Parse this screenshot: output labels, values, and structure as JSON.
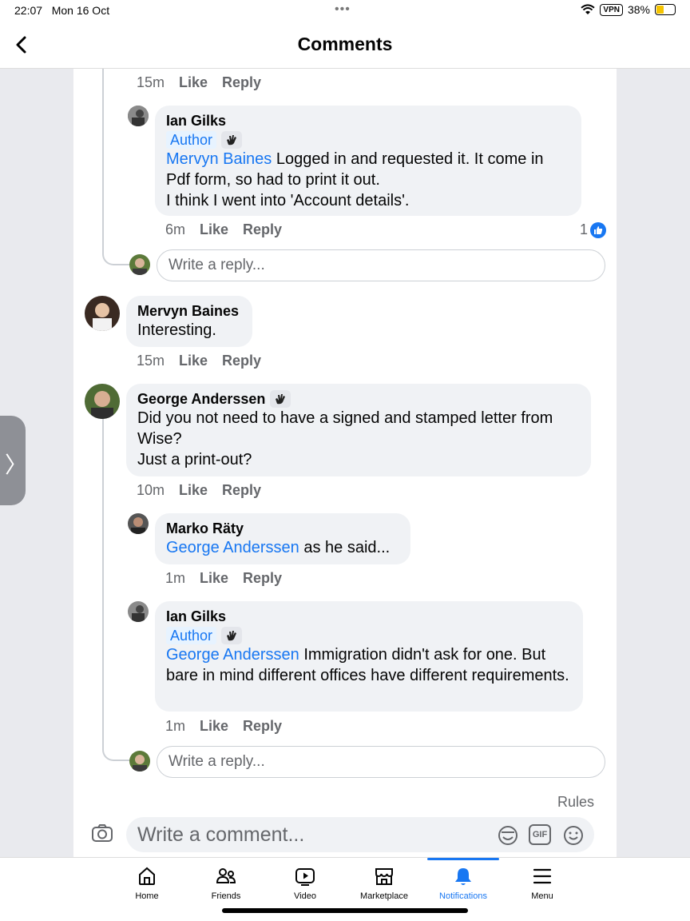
{
  "status_bar": {
    "time": "22:07",
    "date": "Mon 16 Oct",
    "vpn": "VPN",
    "battery": "38%"
  },
  "header": {
    "title": "Comments"
  },
  "comments": [
    {
      "id": "top-actions",
      "time": "15m",
      "like": "Like",
      "reply": "Reply"
    },
    {
      "id": "ian-1",
      "name": "Ian Gilks",
      "badge": "Author",
      "mention": "Mervyn Baines",
      "text": " Logged in and requested it. It come in Pdf form, so had to print it out.",
      "text2": "I think I went into 'Account details'.",
      "time": "6m",
      "like": "Like",
      "reply": "Reply",
      "reactions": "1"
    },
    {
      "id": "mervyn",
      "name": "Mervyn Baines",
      "text": "Interesting.",
      "time": "15m",
      "like": "Like",
      "reply": "Reply"
    },
    {
      "id": "george",
      "name": "George Anderssen",
      "text": "Did you not need to have a signed and stamped letter from Wise?",
      "text2": "Just a print-out?",
      "time": "10m",
      "like": "Like",
      "reply": "Reply"
    },
    {
      "id": "marko",
      "name": "Marko Räty",
      "mention": "George Anderssen",
      "text": " as he said...",
      "time": "1m",
      "like": "Like",
      "reply": "Reply"
    },
    {
      "id": "ian-2",
      "name": "Ian Gilks",
      "badge": "Author",
      "mention": "George Anderssen",
      "text": " Immigration didn't ask for one. But bare in mind different offices have different requirements.",
      "time": "1m",
      "like": "Like",
      "reply": "Reply"
    }
  ],
  "reply_placeholder": "Write a reply...",
  "rules_label": "Rules",
  "comment_placeholder": "Write a comment...",
  "gif_label": "GIF",
  "tabs": [
    {
      "label": "Home",
      "icon": "home-icon"
    },
    {
      "label": "Friends",
      "icon": "friends-icon"
    },
    {
      "label": "Video",
      "icon": "video-icon"
    },
    {
      "label": "Marketplace",
      "icon": "marketplace-icon"
    },
    {
      "label": "Notifications",
      "icon": "bell-icon",
      "active": true
    },
    {
      "label": "Menu",
      "icon": "menu-icon"
    }
  ],
  "colors": {
    "accent": "#1877f2",
    "bubble": "#f0f2f5",
    "muted": "#65676b"
  }
}
